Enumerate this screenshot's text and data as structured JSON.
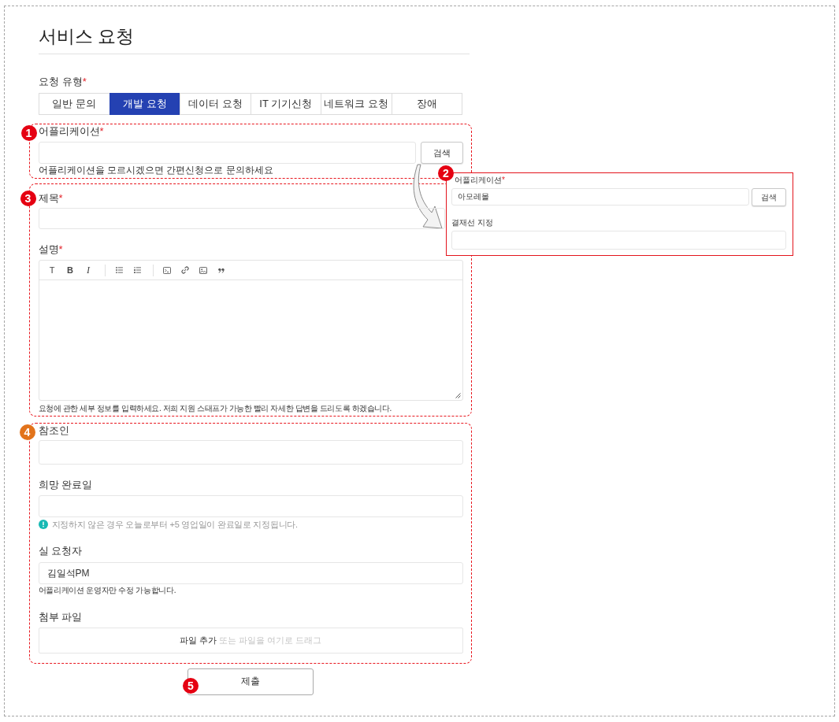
{
  "page": {
    "title": "서비스 요청"
  },
  "request_type": {
    "label": "요청 유형",
    "required_mark": "*",
    "tabs": [
      {
        "label": "일반 문의",
        "selected": false
      },
      {
        "label": "개발 요청",
        "selected": true
      },
      {
        "label": "데이터 요청",
        "selected": false
      },
      {
        "label": "IT 기기신청",
        "selected": false
      },
      {
        "label": "네트워크 요청",
        "selected": false
      },
      {
        "label": "장애",
        "selected": false
      }
    ]
  },
  "application": {
    "label": "어플리케이션",
    "required_mark": "*",
    "search_button": "검색",
    "help": "어플리케이션을 모르시겠으면 간편신청으로 문의하세요"
  },
  "subject": {
    "label": "제목",
    "required_mark": "*"
  },
  "description": {
    "label": "설명",
    "required_mark": "*",
    "format_buttons": [
      {
        "kind": "heading",
        "label": "T"
      },
      {
        "kind": "bold",
        "label": "B"
      },
      {
        "kind": "italic",
        "label": "I"
      }
    ],
    "help": "요청에 관한 세부 정보를 입력하세요. 저희 지원 스태프가 가능한 빨리 자세한 답변을 드리도록 하겠습니다."
  },
  "cc": {
    "label": "참조인"
  },
  "due_date": {
    "label": "희망 완료일",
    "note": "지정하지 않은 경우 오늘로부터 +5 영업일이 완료일로 지정됩니다."
  },
  "requester": {
    "label": "실 요청자",
    "value": "김일석PM",
    "help": "어플리케이션 운영자만 수정 가능합니다."
  },
  "attachment": {
    "label": "첨부 파일",
    "action": "파일 추가",
    "hint": "또는 파일을 여기로 드래그"
  },
  "submit_button": "제출",
  "detail_panel": {
    "application_label": "어플리케이션",
    "required_mark": "*",
    "application_value": "아모레몰",
    "search_button": "검색",
    "approval_label": "결재선 지정"
  },
  "callouts": [
    {
      "number": "1",
      "color": "#e50012"
    },
    {
      "number": "2",
      "color": "#e50012"
    },
    {
      "number": "3",
      "color": "#e50012"
    },
    {
      "number": "4",
      "color": "#e2731b"
    },
    {
      "number": "5",
      "color": "#e50012"
    }
  ]
}
